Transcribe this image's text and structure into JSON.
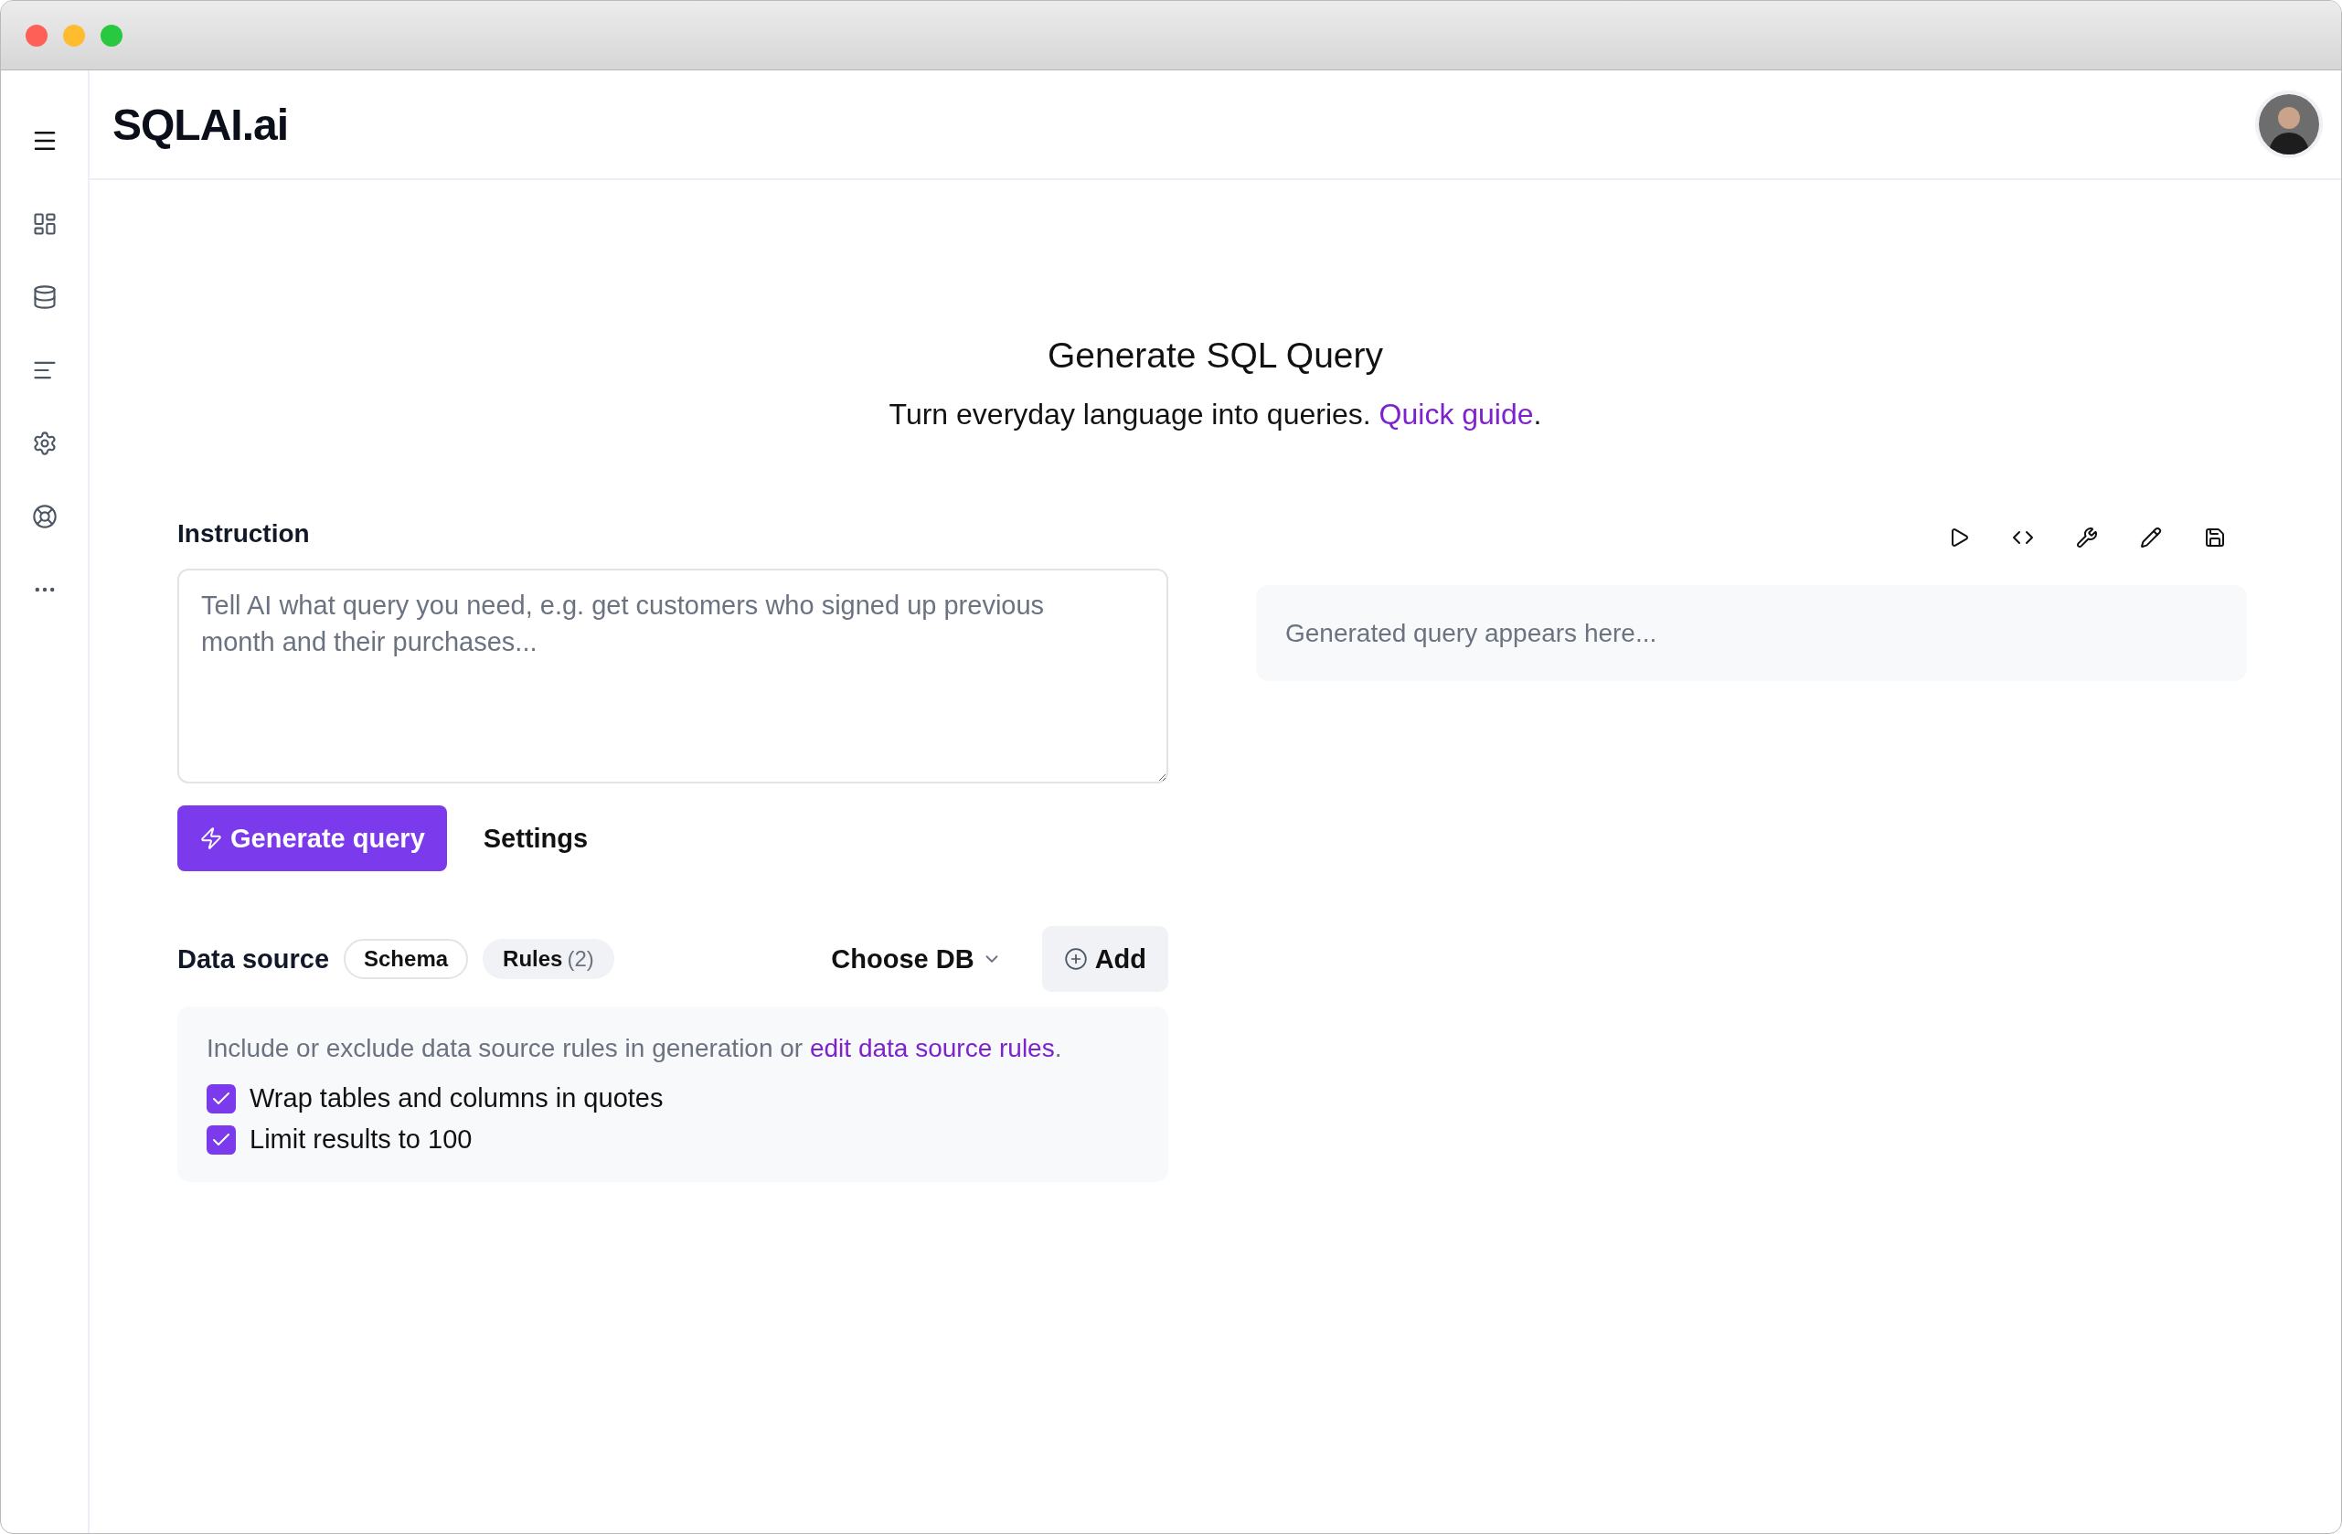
{
  "app": {
    "logo": "SQLAI.ai"
  },
  "hero": {
    "title": "Generate SQL Query",
    "subtitle": "Turn everyday language into queries.",
    "link": "Quick guide",
    "end": "."
  },
  "instruction": {
    "label": "Instruction",
    "placeholder": "Tell AI what query you need, e.g. get customers who signed up previous month and their purchases..."
  },
  "actions": {
    "generate": "Generate query",
    "settings": "Settings"
  },
  "data_source": {
    "label": "Data source",
    "tabs": [
      {
        "label": "Schema",
        "selected": false
      },
      {
        "label": "Rules",
        "count": "(2)",
        "selected": true
      }
    ],
    "choose_db": "Choose DB",
    "add": "Add"
  },
  "rules_panel": {
    "intro": "Include or exclude data source rules in generation or",
    "link": "edit data source rules",
    "end": ".",
    "rules": [
      {
        "label": "Wrap tables and columns in quotes",
        "checked": true
      },
      {
        "label": "Limit results to 100",
        "checked": true
      }
    ]
  },
  "output": {
    "placeholder": "Generated query appears here..."
  }
}
